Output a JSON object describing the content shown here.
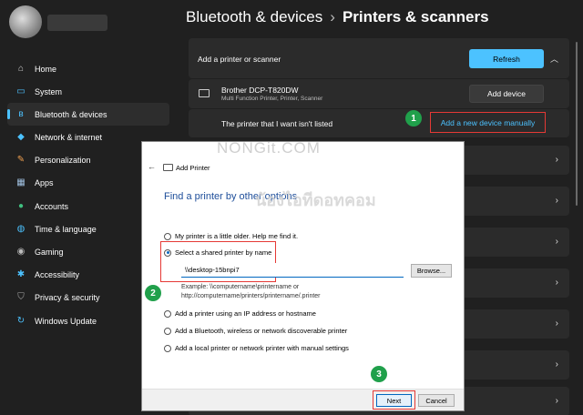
{
  "header": {
    "parent": "Bluetooth & devices",
    "current": "Printers & scanners"
  },
  "sidebar": {
    "items": [
      {
        "label": "Home",
        "icon": "home-icon",
        "glyph": "⌂",
        "color": "#cfcfcf"
      },
      {
        "label": "System",
        "icon": "monitor-icon",
        "glyph": "▭",
        "color": "#4cc2ff"
      },
      {
        "label": "Bluetooth & devices",
        "icon": "bluetooth-icon",
        "glyph": "ʙ",
        "color": "#4cc2ff",
        "active": true
      },
      {
        "label": "Network & internet",
        "icon": "wifi-icon",
        "glyph": "◆",
        "color": "#4cc2ff"
      },
      {
        "label": "Personalization",
        "icon": "brush-icon",
        "glyph": "✎",
        "color": "#f0a050"
      },
      {
        "label": "Apps",
        "icon": "apps-icon",
        "glyph": "▦",
        "color": "#a0c0e0"
      },
      {
        "label": "Accounts",
        "icon": "person-icon",
        "glyph": "●",
        "color": "#40c080"
      },
      {
        "label": "Time & language",
        "icon": "globe-icon",
        "glyph": "◍",
        "color": "#4cc2ff"
      },
      {
        "label": "Gaming",
        "icon": "gamepad-icon",
        "glyph": "◉",
        "color": "#bbbbbb"
      },
      {
        "label": "Accessibility",
        "icon": "accessibility-icon",
        "glyph": "✱",
        "color": "#4cc2ff"
      },
      {
        "label": "Privacy & security",
        "icon": "shield-icon",
        "glyph": "⛉",
        "color": "#aaaaaa"
      },
      {
        "label": "Windows Update",
        "icon": "update-icon",
        "glyph": "↻",
        "color": "#4cc2ff"
      }
    ]
  },
  "add_panel": {
    "label": "Add a printer or scanner",
    "refresh_label": "Refresh"
  },
  "device": {
    "name": "Brother DCP-T820DW",
    "subtitle": "Multi Function Printer, Printer, Scanner",
    "add_label": "Add device"
  },
  "not_listed": {
    "label": "The printer that I want isn't listed",
    "link": "Add a new device manually"
  },
  "watermark": {
    "line1": "NONGit.COM",
    "line2": "น้องไอทีดอทคอม"
  },
  "badges": {
    "one": "1",
    "two": "2",
    "three": "3"
  },
  "dialog": {
    "title": "Add Printer",
    "heading": "Find a printer by other options",
    "options": {
      "older": "My printer is a little older. Help me find it.",
      "shared": "Select a shared printer by name",
      "ip": "Add a printer using an IP address or hostname",
      "bluetooth": "Add a Bluetooth, wireless or network discoverable printer",
      "local": "Add a local printer or network printer with manual settings"
    },
    "path_value": "\\\\desktop-15bnpi7",
    "browse_label": "Browse...",
    "example_line1": "Example: \\\\computername\\printername or",
    "example_line2": "http://computername/printers/printername/.printer",
    "next_label": "Next",
    "cancel_label": "Cancel"
  },
  "colors": {
    "accent": "#4cc2ff",
    "highlight": "#e53935",
    "badge": "#20a04b",
    "dialog_heading": "#1e4e9a"
  }
}
